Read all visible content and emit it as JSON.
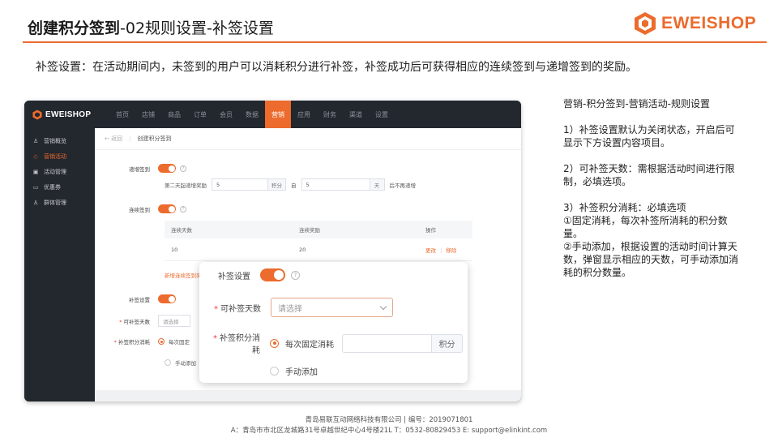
{
  "slide": {
    "title_bold": "创建积分签到",
    "title_rest": "-02规则设置-补签设置",
    "brand": "EWEISHOP",
    "brand_color": "#ec6b2d",
    "intro": "补签设置：在活动期间内，未签到的用户可以消耗积分进行补签，补签成功后可获得相应的连续签到与递增签到的奖励。"
  },
  "app": {
    "logo": "EWEISHOP",
    "nav": [
      "首页",
      "店铺",
      "商品",
      "订单",
      "会员",
      "数据",
      "营销",
      "应用",
      "财务",
      "渠道",
      "设置"
    ],
    "active_nav": "营销",
    "sidebar": [
      {
        "icon": "user-icon",
        "glyph": "♙",
        "label": "营销概览",
        "active": false
      },
      {
        "icon": "tag-icon",
        "glyph": "◇",
        "label": "营销活动",
        "active": true
      },
      {
        "icon": "grid-icon",
        "glyph": "▣",
        "label": "活动管理",
        "active": false
      },
      {
        "icon": "coupon-icon",
        "glyph": "▭",
        "label": "优惠券",
        "active": false
      },
      {
        "icon": "group-icon",
        "glyph": "♙",
        "label": "群体管理",
        "active": false
      }
    ],
    "breadcrumb": {
      "back": "← 返回",
      "current": "创建积分签到"
    },
    "form": {
      "increase_label": "递增签到",
      "increase_sub": "第二天起递增奖励",
      "increase_value": "5",
      "increase_unit": "积分",
      "to": "自",
      "day_value": "5",
      "day_unit": "天",
      "after": "后不再递增",
      "continuous_label": "连续签到",
      "table_headers": [
        "连续天数",
        "连续奖励",
        "操作"
      ],
      "table_rows": [
        {
          "days": "10",
          "reward": "20",
          "edit": "更改",
          "sep": "|",
          "remove": "移除"
        }
      ],
      "add_link": "新增连续签到奖",
      "makeup_label": "补签设置",
      "days_label": "可补签天数",
      "days_placeholder": "请选择",
      "cost_label": "补签积分消耗",
      "cost_fixed": "每次固定",
      "cost_manual": "手动添加"
    },
    "popup": {
      "makeup_label": "补签设置",
      "days_label": "可补签天数",
      "days_placeholder": "请选择",
      "cost_label": "补签积分消耗",
      "fixed_label": "每次固定消耗",
      "fixed_unit": "积分",
      "manual_label": "手动添加"
    }
  },
  "notes": {
    "path": "营销-积分签到-营销活动-规则设置",
    "p1": "1）补签设置默认为关闭状态，开启后可显示下方设置内容项目。",
    "p2": "2）可补签天数：需根据活动时间进行限制，必填选项。",
    "p3_title": "3）补签积分消耗：必填选项",
    "p3_a": "①固定消耗，每次补签所消耗的积分数量。",
    "p3_b": "②手动添加，根据设置的活动时间计算天数，弹窗显示相应的天数，可手动添加消耗的积分数量。"
  },
  "footer": {
    "line1": "青岛易联互动网络科技有限公司 | 编号：2019071801",
    "line2": "A：青岛市市北区龙城路31号卓越世纪中心4号楼21L   T：0532-80829453    E: support@elinkint.com"
  }
}
